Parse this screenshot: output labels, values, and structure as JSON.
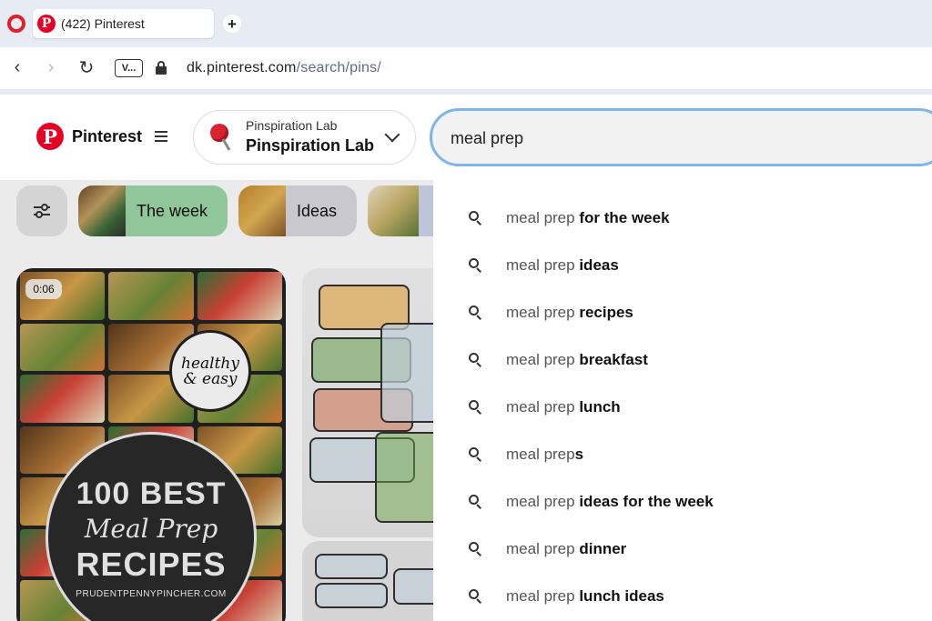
{
  "browser": {
    "tab_title": "(422) Pinterest",
    "tab_favicon": "P",
    "new_tab_symbol": "+",
    "vpn_badge": "V...",
    "url_host": "dk.pinterest.com",
    "url_path": "/search/pins/",
    "icons": [
      "opera-logo-icon",
      "back-arrow-icon",
      "forward-arrow-icon",
      "reload-icon",
      "lock-icon"
    ]
  },
  "header": {
    "logo_letter": "P",
    "brand": "Pinterest",
    "board_subtitle": "Pinspiration Lab",
    "board_name": "Pinspiration Lab",
    "search_value": "meal prep",
    "colors": {
      "brand_red": "#e60023",
      "search_focus": "#7fb4ec"
    }
  },
  "content": {
    "chips": [
      {
        "label": "The week"
      },
      {
        "label": "Ideas"
      },
      {
        "label": ""
      }
    ],
    "pin1": {
      "duration": "0:06",
      "sticker": "healthy & easy",
      "title_line1": "100 BEST",
      "title_line2": "Meal Prep",
      "title_line3": "RECIPES",
      "source": "PRUDENTPENNYPINCHER.COM"
    }
  },
  "suggestions": {
    "query": "meal prep",
    "items": [
      {
        "prefix": "meal prep",
        "completion": " for the week"
      },
      {
        "prefix": "meal prep",
        "completion": " ideas"
      },
      {
        "prefix": "meal prep",
        "completion": " recipes"
      },
      {
        "prefix": "meal prep",
        "completion": " breakfast"
      },
      {
        "prefix": "meal prep",
        "completion": " lunch"
      },
      {
        "prefix": "meal prep",
        "completion": "s"
      },
      {
        "prefix": "meal prep",
        "completion": " ideas for the week"
      },
      {
        "prefix": "meal prep",
        "completion": " dinner"
      },
      {
        "prefix": "meal prep",
        "completion": " lunch ideas"
      }
    ]
  }
}
